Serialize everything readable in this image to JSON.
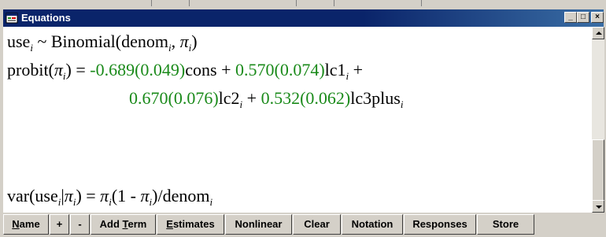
{
  "window": {
    "title": "Equations"
  },
  "icons": {
    "app": "app-window-icon"
  },
  "titlebar_buttons": {
    "minimize": "_",
    "maximize": "□",
    "close": "×"
  },
  "equation": {
    "line1": {
      "lhs": "use",
      "lhs_sub": "i",
      "tilde": " ~ Binomial(denom",
      "sub1": "i",
      "comma": ", ",
      "pi": "π",
      "sub2": "i",
      "close": ")"
    },
    "line2": {
      "probit": "probit(",
      "pi": "π",
      "sub_pi": "i",
      "eq": ") = ",
      "c1": "-0.689(0.049)",
      "t1": "cons + ",
      "c2": "0.570(0.074)",
      "t2": "lc1",
      "sub_t2": "i",
      "plus": " +"
    },
    "line3": {
      "c3": "0.670(0.076)",
      "t3": "lc2",
      "sub_t3": "i",
      "plus": " + ",
      "c4": "0.532(0.062)",
      "t4": "lc3plus",
      "sub_t4": "i"
    },
    "line4": {
      "var": "var(use",
      "sub_use": "i",
      "bar": "|",
      "pi": "π",
      "sub_pi": "i",
      "eq": ") = ",
      "pi2": "π",
      "sub_pi2": "i",
      "mid": "(1 - ",
      "pi3": "π",
      "sub_pi3": "i",
      "tail": ")/denom",
      "sub_denom": "i"
    }
  },
  "toolbar": [
    {
      "pre": "",
      "mn": "N",
      "post": "ame"
    },
    {
      "pre": "+",
      "mn": "",
      "post": ""
    },
    {
      "pre": "-",
      "mn": "",
      "post": ""
    },
    {
      "pre": "Add ",
      "mn": "T",
      "post": "erm"
    },
    {
      "pre": "",
      "mn": "E",
      "post": "stimates"
    },
    {
      "pre": "Nonlinear",
      "mn": "",
      "post": ""
    },
    {
      "pre": "Clear",
      "mn": "",
      "post": ""
    },
    {
      "pre": "Notation",
      "mn": "",
      "post": ""
    },
    {
      "pre": "Responses",
      "mn": "",
      "post": ""
    },
    {
      "pre": "Store",
      "mn": "",
      "post": ""
    }
  ]
}
